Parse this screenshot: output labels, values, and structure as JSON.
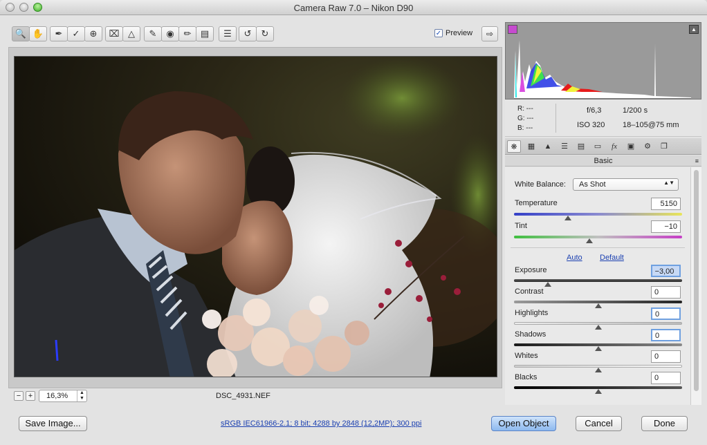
{
  "window": {
    "title": "Camera Raw 7.0  –  Nikon D90"
  },
  "toolbar": {
    "tools": [
      "zoom-icon",
      "hand-icon",
      "white-balance-icon",
      "color-sampler-icon",
      "target-adjust-icon",
      "crop-icon",
      "straighten-icon",
      "spot-removal-icon",
      "red-eye-icon",
      "adjustment-brush-icon",
      "graduated-filter-icon",
      "preferences-icon",
      "rotate-ccw-icon",
      "rotate-cw-icon"
    ],
    "preview_label": "Preview",
    "preview_checked": "✓"
  },
  "image": {
    "filename": "DSC_4931.NEF"
  },
  "zoom": {
    "minus": "−",
    "plus": "+",
    "value": "16,3%"
  },
  "info": {
    "r": "R:",
    "r_val": "---",
    "g": "G:",
    "g_val": "---",
    "b": "B:",
    "b_val": "---",
    "aperture": "f/6,3",
    "shutter": "1/200 s",
    "iso": "ISO 320",
    "lens": "18–105@75 mm"
  },
  "panel": {
    "section_title": "Basic",
    "menu_icon": "≡",
    "white_balance_label": "White Balance:",
    "white_balance_value": "As Shot",
    "auto_label": "Auto",
    "default_label": "Default",
    "sliders": [
      {
        "label": "Temperature",
        "value": "5150",
        "position": 0.32
      },
      {
        "label": "Tint",
        "value": "−10",
        "position": 0.45
      },
      {
        "label": "Exposure",
        "value": "−3,00",
        "position": 0.2
      },
      {
        "label": "Contrast",
        "value": "0",
        "position": 0.5
      },
      {
        "label": "Highlights",
        "value": "0",
        "position": 0.5
      },
      {
        "label": "Shadows",
        "value": "0",
        "position": 0.5
      },
      {
        "label": "Whites",
        "value": "0",
        "position": 0.5
      },
      {
        "label": "Blacks",
        "value": "0",
        "position": 0.5
      }
    ]
  },
  "bottom": {
    "save_label": "Save Image...",
    "workflow_label": "sRGB IEC61966-2.1; 8 bit; 4288 by 2848 (12,2MP); 300 ppi",
    "open_label": "Open Object",
    "cancel_label": "Cancel",
    "done_label": "Done"
  },
  "colors": {
    "accent": "#8db9ef",
    "link": "#1a3fb0"
  }
}
